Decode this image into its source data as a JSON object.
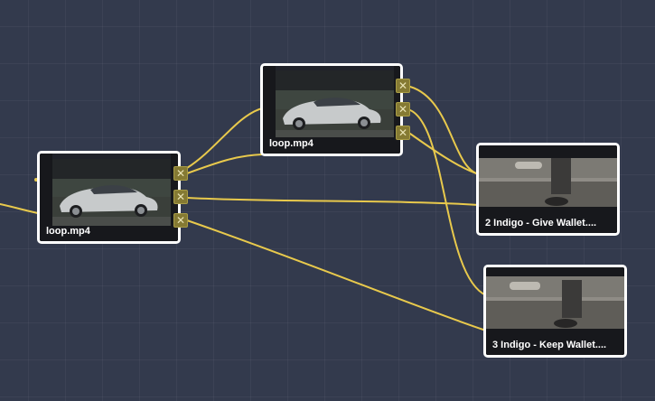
{
  "canvas": {
    "background": "#333a4d",
    "wire_color": "#e8c94c",
    "port_color": "#857a33"
  },
  "nodes": [
    {
      "id": "node-loop-1",
      "label": "loop.mp4",
      "thumbnail": "car-video-frame"
    },
    {
      "id": "node-loop-2",
      "label": "loop.mp4",
      "thumbnail": "car-video-frame"
    },
    {
      "id": "node-give-wallet",
      "label": "2 Indigo - Give Wallet....",
      "thumbnail": "street-curb-feet-frame"
    },
    {
      "id": "node-keep-wallet",
      "label": "3 Indigo - Keep Wallet....",
      "thumbnail": "street-curb-feet-frame"
    }
  ],
  "port_icon": "close-icon",
  "port_glyph": "✕"
}
